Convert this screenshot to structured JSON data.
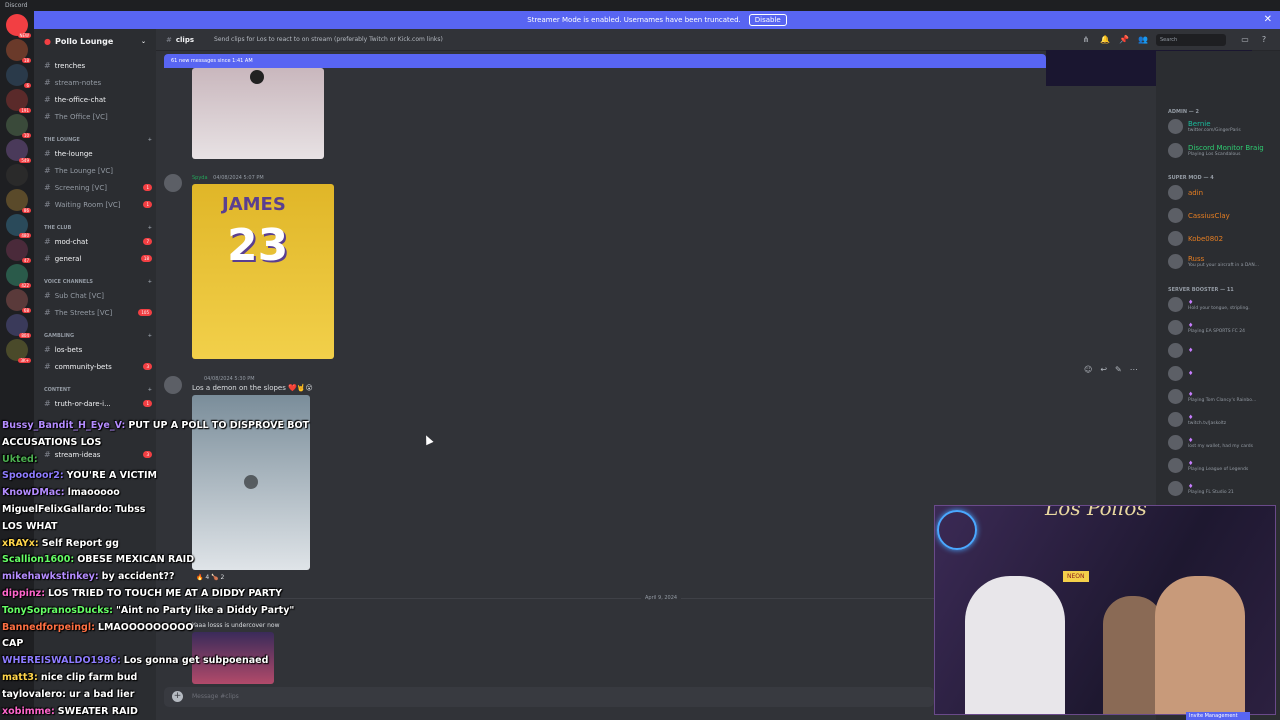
{
  "app": {
    "title": "Discord"
  },
  "banner": {
    "text": "Streamer Mode is enabled. Usernames have been truncated.",
    "button": "Disable"
  },
  "servers": [
    {
      "badge": "NEW"
    },
    {
      "badge": "18"
    },
    {
      "badge": "6"
    },
    {
      "badge": "191"
    },
    {
      "badge": "10"
    },
    {
      "badge": "549"
    },
    {
      "badge": ""
    },
    {
      "badge": "86"
    },
    {
      "badge": "480"
    },
    {
      "badge": "47"
    },
    {
      "badge": "422"
    },
    {
      "badge": "68"
    },
    {
      "badge": "804"
    },
    {
      "badge": "3K+"
    }
  ],
  "sidebar": {
    "server_name": "Pollo Lounge",
    "channels": [
      {
        "label": "trenches",
        "bright": true,
        "badge": ""
      },
      {
        "label": "stream-notes",
        "bright": false,
        "badge": ""
      },
      {
        "label": "the-office-chat",
        "bright": true,
        "badge": ""
      },
      {
        "label": "The Office [VC]",
        "bright": false,
        "badge": ""
      }
    ],
    "cat_lounge": "THE LOUNGE",
    "lounge": [
      {
        "label": "the-lounge",
        "bright": true,
        "badge": ""
      },
      {
        "label": "The Lounge [VC]",
        "bright": false,
        "badge": ""
      },
      {
        "label": "Screening [VC]",
        "bright": false,
        "badge": "1"
      },
      {
        "label": "Waiting Room [VC]",
        "bright": false,
        "badge": "1"
      }
    ],
    "cat_club": "THE CLUB",
    "club": [
      {
        "label": "mod-chat",
        "bright": true,
        "badge": "7"
      },
      {
        "label": "general",
        "bright": true,
        "badge": "18"
      }
    ],
    "cat_voice": "VOICE CHANNELS",
    "voice": [
      {
        "label": "Sub Chat [VC]",
        "bright": false,
        "badge": ""
      },
      {
        "label": "The Streets [VC]",
        "bright": false,
        "badge": "105"
      }
    ],
    "cat_gambling": "GAMBLING",
    "gambling": [
      {
        "label": "los-bets",
        "bright": true,
        "badge": ""
      },
      {
        "label": "community-bets",
        "bright": true,
        "badge": "3"
      }
    ],
    "cat_content": "CONTENT",
    "content": [
      {
        "label": "truth-or-dare-i...",
        "bright": true,
        "badge": "1"
      },
      {
        "label": "stream-ideas",
        "bright": true,
        "badge": "3"
      }
    ]
  },
  "topbar": {
    "channel": "clips",
    "topic": "Send clips for Los to react to on stream (preferably Twitch or Kick.com links)",
    "search_placeholder": "Search"
  },
  "newmsg": "61 new messages since 1:41 AM",
  "messages": [
    {
      "name": "Spyda",
      "time": "04/08/2024 5:07 PM",
      "text": "",
      "jersey_name": "JAMES",
      "jersey_number": "23"
    },
    {
      "name": "",
      "time": "04/08/2024 5:30 PM",
      "text": "Los a demon on the slopes ❤️🤘😮",
      "reactions": "🔥 4   🍗 2"
    },
    {
      "name": "",
      "time": "",
      "text": "Yaaa losss is undercover now"
    }
  ],
  "date_divider": "April 9, 2024",
  "input_placeholder": "Message #clips",
  "members": {
    "cat_admin": "ADMIN — 2",
    "admin": [
      {
        "name": "Bernie",
        "sub": "twitter.com/GingerParis",
        "color": "#1abc9c"
      },
      {
        "name": "Discord Monitor Braig",
        "sub": "Playing Los Scandalous",
        "color": "#2ecc71"
      }
    ],
    "cat_super": "SUPER MOD — 4",
    "super": [
      {
        "name": "adin",
        "sub": "",
        "color": "#e67e22"
      },
      {
        "name": "CassiusClay",
        "sub": "",
        "color": "#e67e22"
      },
      {
        "name": "Kobe0802",
        "sub": "",
        "color": "#e67e22"
      },
      {
        "name": "Russ",
        "sub": "You put your aircraft in a DAN...",
        "color": "#e67e22"
      }
    ],
    "cat_booster": "SERVER BOOSTER — 11",
    "booster": [
      {
        "sub": "Hold your tongue, stripling."
      },
      {
        "sub": "Playing EA SPORTS FC 24"
      },
      {
        "sub": ""
      },
      {
        "sub": ""
      },
      {
        "sub": "Playing Tom Clancy's Rainbo..."
      },
      {
        "sub": "twitch.tv/Jaskoltz"
      },
      {
        "sub": "lost my wallet, had my cards"
      },
      {
        "sub": "Playing League of Legends"
      },
      {
        "sub": "Playing FL Studio 21"
      }
    ]
  },
  "stream_chat": [
    {
      "user": "Bussy_Bandit_H_Eye_V:",
      "msg": "PUT UP A POLL TO DISPROVE BOT ACCUSATIONS LOS",
      "color": "#b48cff"
    },
    {
      "user": "Ukted:",
      "msg": "",
      "color": "#4caf50"
    },
    {
      "user": "Spoodoor2:",
      "msg": "YOU'RE A VICTIM",
      "color": "#8e7cff"
    },
    {
      "user": "KnowDMac:",
      "msg": "lmaooooo",
      "color": "#b48cff"
    },
    {
      "user": "MiguelFelixGallardo:",
      "msg": "Tubss",
      "color": "#ffffff"
    },
    {
      "user": "",
      "msg": "LOS WHAT",
      "color": "#ff4d4d"
    },
    {
      "user": "xRAYx:",
      "msg": "Self Report gg",
      "color": "#ffd54a"
    },
    {
      "user": "Scallion1600:",
      "msg": "OBESE MEXICAN RAID",
      "color": "#66ff66"
    },
    {
      "user": "mikehawkstinkey:",
      "msg": "by accident??",
      "color": "#b48cff"
    },
    {
      "user": "dippinz:",
      "msg": "LOS TRIED TO TOUCH ME AT A DIDDY PARTY",
      "color": "#ff66cc"
    },
    {
      "user": "TonySopranosDucks:",
      "msg": "\"Aint no Party like a Diddy Party\"",
      "color": "#66ff66"
    },
    {
      "user": "Bannedforpeingl:",
      "msg": "LMAOOOOOOOOO",
      "color": "#ff7043"
    },
    {
      "user": "",
      "msg": "CAP",
      "color": "#ffffff"
    },
    {
      "user": "WHEREISWALDO1986:",
      "msg": "Los gonna get subpoenaed",
      "color": "#8e7cff"
    },
    {
      "user": "matt3:",
      "msg": "nice clip farm bud",
      "color": "#ffd54a"
    },
    {
      "user": "taylovalero:",
      "msg": "ur a bad lier",
      "color": "#ffffff"
    },
    {
      "user": "xobimme:",
      "msg": "SWEATER RAID",
      "color": "#ff66cc"
    }
  ],
  "cam": {
    "logo_text": "Los Pollos",
    "sign_text": "NEON",
    "bottom_btn": "Invite Management"
  }
}
